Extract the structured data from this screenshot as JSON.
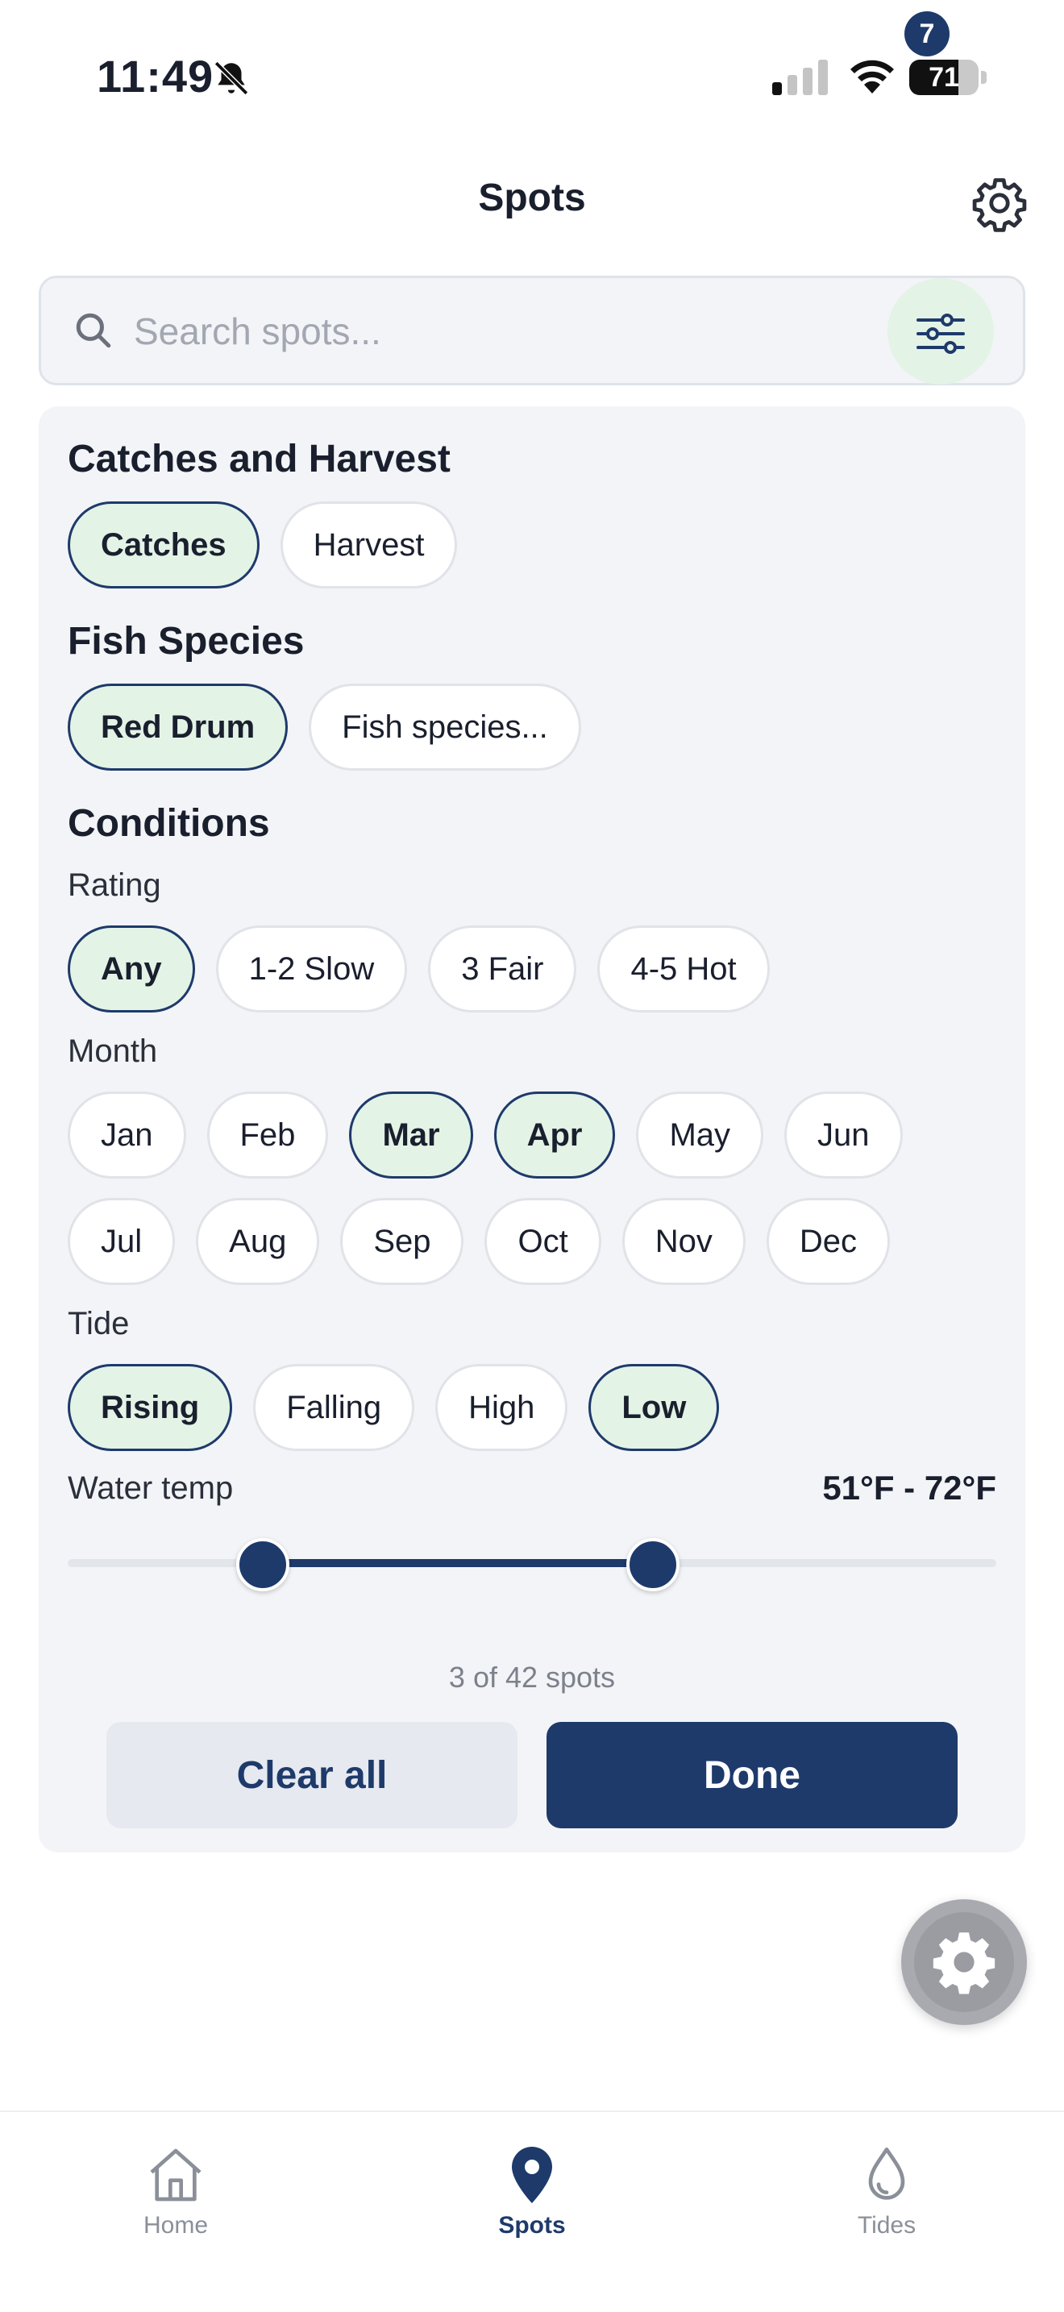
{
  "status_bar": {
    "time": "11:49",
    "battery": "71",
    "battery_level": 0.71
  },
  "header": {
    "title": "Spots",
    "settings_icon": "gear-icon"
  },
  "search": {
    "placeholder": "Search spots...",
    "value": "",
    "filter_badge": "7"
  },
  "filters": {
    "catches_harvest": {
      "title": "Catches and Harvest",
      "options": [
        {
          "label": "Catches",
          "selected": true
        },
        {
          "label": "Harvest",
          "selected": false
        }
      ]
    },
    "species": {
      "title": "Fish Species",
      "options": [
        {
          "label": "Red Drum",
          "selected": true
        },
        {
          "label": "Fish species...",
          "selected": false
        }
      ]
    },
    "conditions": {
      "title": "Conditions",
      "rating": {
        "label": "Rating",
        "options": [
          {
            "label": "Any",
            "selected": true
          },
          {
            "label": "1-2 Slow",
            "selected": false
          },
          {
            "label": "3 Fair",
            "selected": false
          },
          {
            "label": "4-5 Hot",
            "selected": false
          }
        ]
      },
      "month": {
        "label": "Month",
        "options": [
          {
            "label": "Jan",
            "selected": false
          },
          {
            "label": "Feb",
            "selected": false
          },
          {
            "label": "Mar",
            "selected": true
          },
          {
            "label": "Apr",
            "selected": true
          },
          {
            "label": "May",
            "selected": false
          },
          {
            "label": "Jun",
            "selected": false
          },
          {
            "label": "Jul",
            "selected": false
          },
          {
            "label": "Aug",
            "selected": false
          },
          {
            "label": "Sep",
            "selected": false
          },
          {
            "label": "Oct",
            "selected": false
          },
          {
            "label": "Nov",
            "selected": false
          },
          {
            "label": "Dec",
            "selected": false
          }
        ]
      },
      "tide": {
        "label": "Tide",
        "options": [
          {
            "label": "Rising",
            "selected": true
          },
          {
            "label": "Falling",
            "selected": false
          },
          {
            "label": "High",
            "selected": false
          },
          {
            "label": "Low",
            "selected": true
          }
        ]
      },
      "water_temp": {
        "label": "Water temp",
        "value_text": "51°F - 72°F",
        "slider_low_fraction": 0.21,
        "slider_high_fraction": 0.63
      }
    }
  },
  "results": {
    "count_text": "3 of 42 spots"
  },
  "actions": {
    "clear_label": "Clear all",
    "done_label": "Done"
  },
  "tabs": [
    {
      "label": "Home",
      "icon": "home-icon",
      "active": false
    },
    {
      "label": "Spots",
      "icon": "map-pin-icon",
      "active": true
    },
    {
      "label": "Tides",
      "icon": "water-drop-icon",
      "active": false
    }
  ],
  "colors": {
    "primary": "#1e3a6b",
    "selected_chip_bg": "#e3f3e6",
    "panel_bg": "#f3f4f7"
  }
}
